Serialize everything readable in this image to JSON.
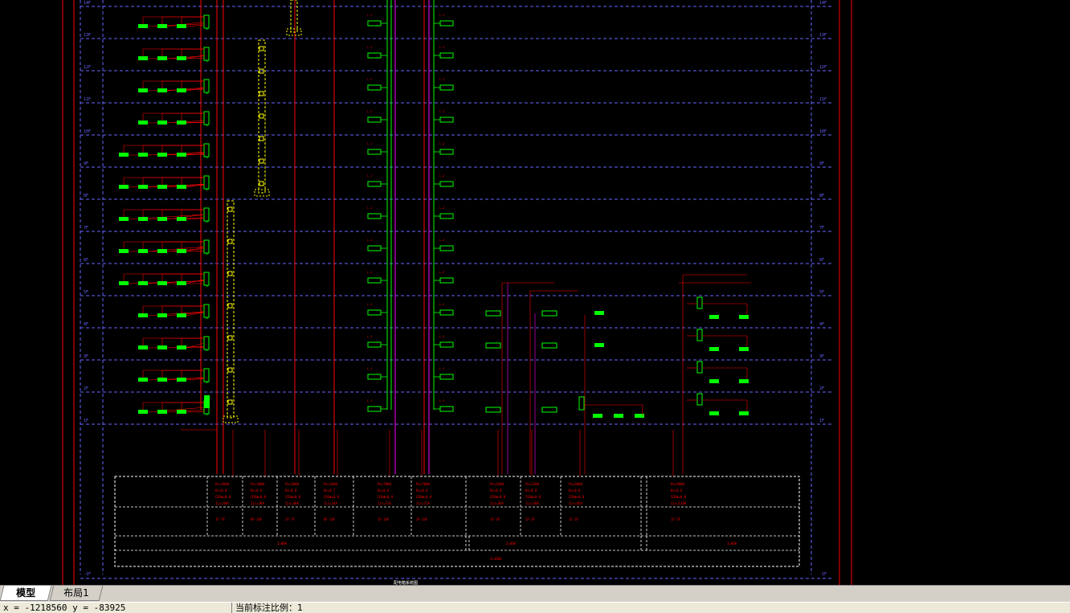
{
  "colors": {
    "background": "#000000",
    "red": "#ff0000",
    "green": "#00ff00",
    "blue_dash": "#6666ff",
    "magenta": "#ff00ff",
    "yellow": "#ffff00",
    "tab_bar": "#d4d0c8",
    "status_bar": "#ece9d8"
  },
  "drawing": {
    "floor_labels": [
      "14F",
      "13F",
      "12F",
      "11F",
      "10F",
      "9F",
      "8F",
      "7F",
      "6F",
      "5F",
      "4F",
      "3F",
      "2F",
      "1F"
    ],
    "bottom_label": "-1F",
    "table": {
      "power_rows": [
        "Pe=36kW",
        "Pe=18kW",
        "Pe=20kW",
        "Pe=16kW",
        "Pe=70kW",
        "Pe=70kW",
        "Pe=24kW",
        "Pe=12kW",
        "Pe=30kW",
        "Pe=96kW"
      ],
      "row2": [
        "Kx=0.8",
        "Kx=0.9",
        "Kx=0.8",
        "Kx=0.7",
        "Kx=0.6",
        "Kx=0.6",
        "Kx=0.8",
        "Kx=0.8",
        "Kx=0.8",
        "Kx=0.6"
      ],
      "row3": [
        "COSΦ=0.8",
        "COSΦ=0.8",
        "COSΦ=0.8",
        "COSΦ=0.8",
        "COSΦ=0.9",
        "COSΦ=0.9",
        "COSΦ=0.8",
        "COSΦ=0.8",
        "COSΦ=0.8",
        "COSΦ=0.8"
      ],
      "row4": [
        "Ijs=58A",
        "Ijs=30A",
        "Ijs=30A",
        "Ijs=24A",
        "Ijs=71A",
        "Ijs=71A",
        "Ijs=36A",
        "Ijs=18A",
        "Ijs=45A",
        "Ijs=110A"
      ],
      "range_row": [
        "1F-7F",
        "8F-14F",
        "1F-7F",
        "8F-14F",
        "1F-14F",
        "1F-14F",
        "1F-3F",
        "1F-3F",
        "1F-3F",
        "1F-5F"
      ],
      "bottom_cells": [
        "I=80A",
        "I=60A",
        "I=60A"
      ],
      "total": "I=160A"
    },
    "caption": "配电箱系统图"
  },
  "tabs": [
    {
      "label": "模型",
      "active": true
    },
    {
      "label": "布局1",
      "active": false
    }
  ],
  "status": {
    "coords": "x = -1218560  y = -83925",
    "scale": "当前标注比例：1"
  }
}
